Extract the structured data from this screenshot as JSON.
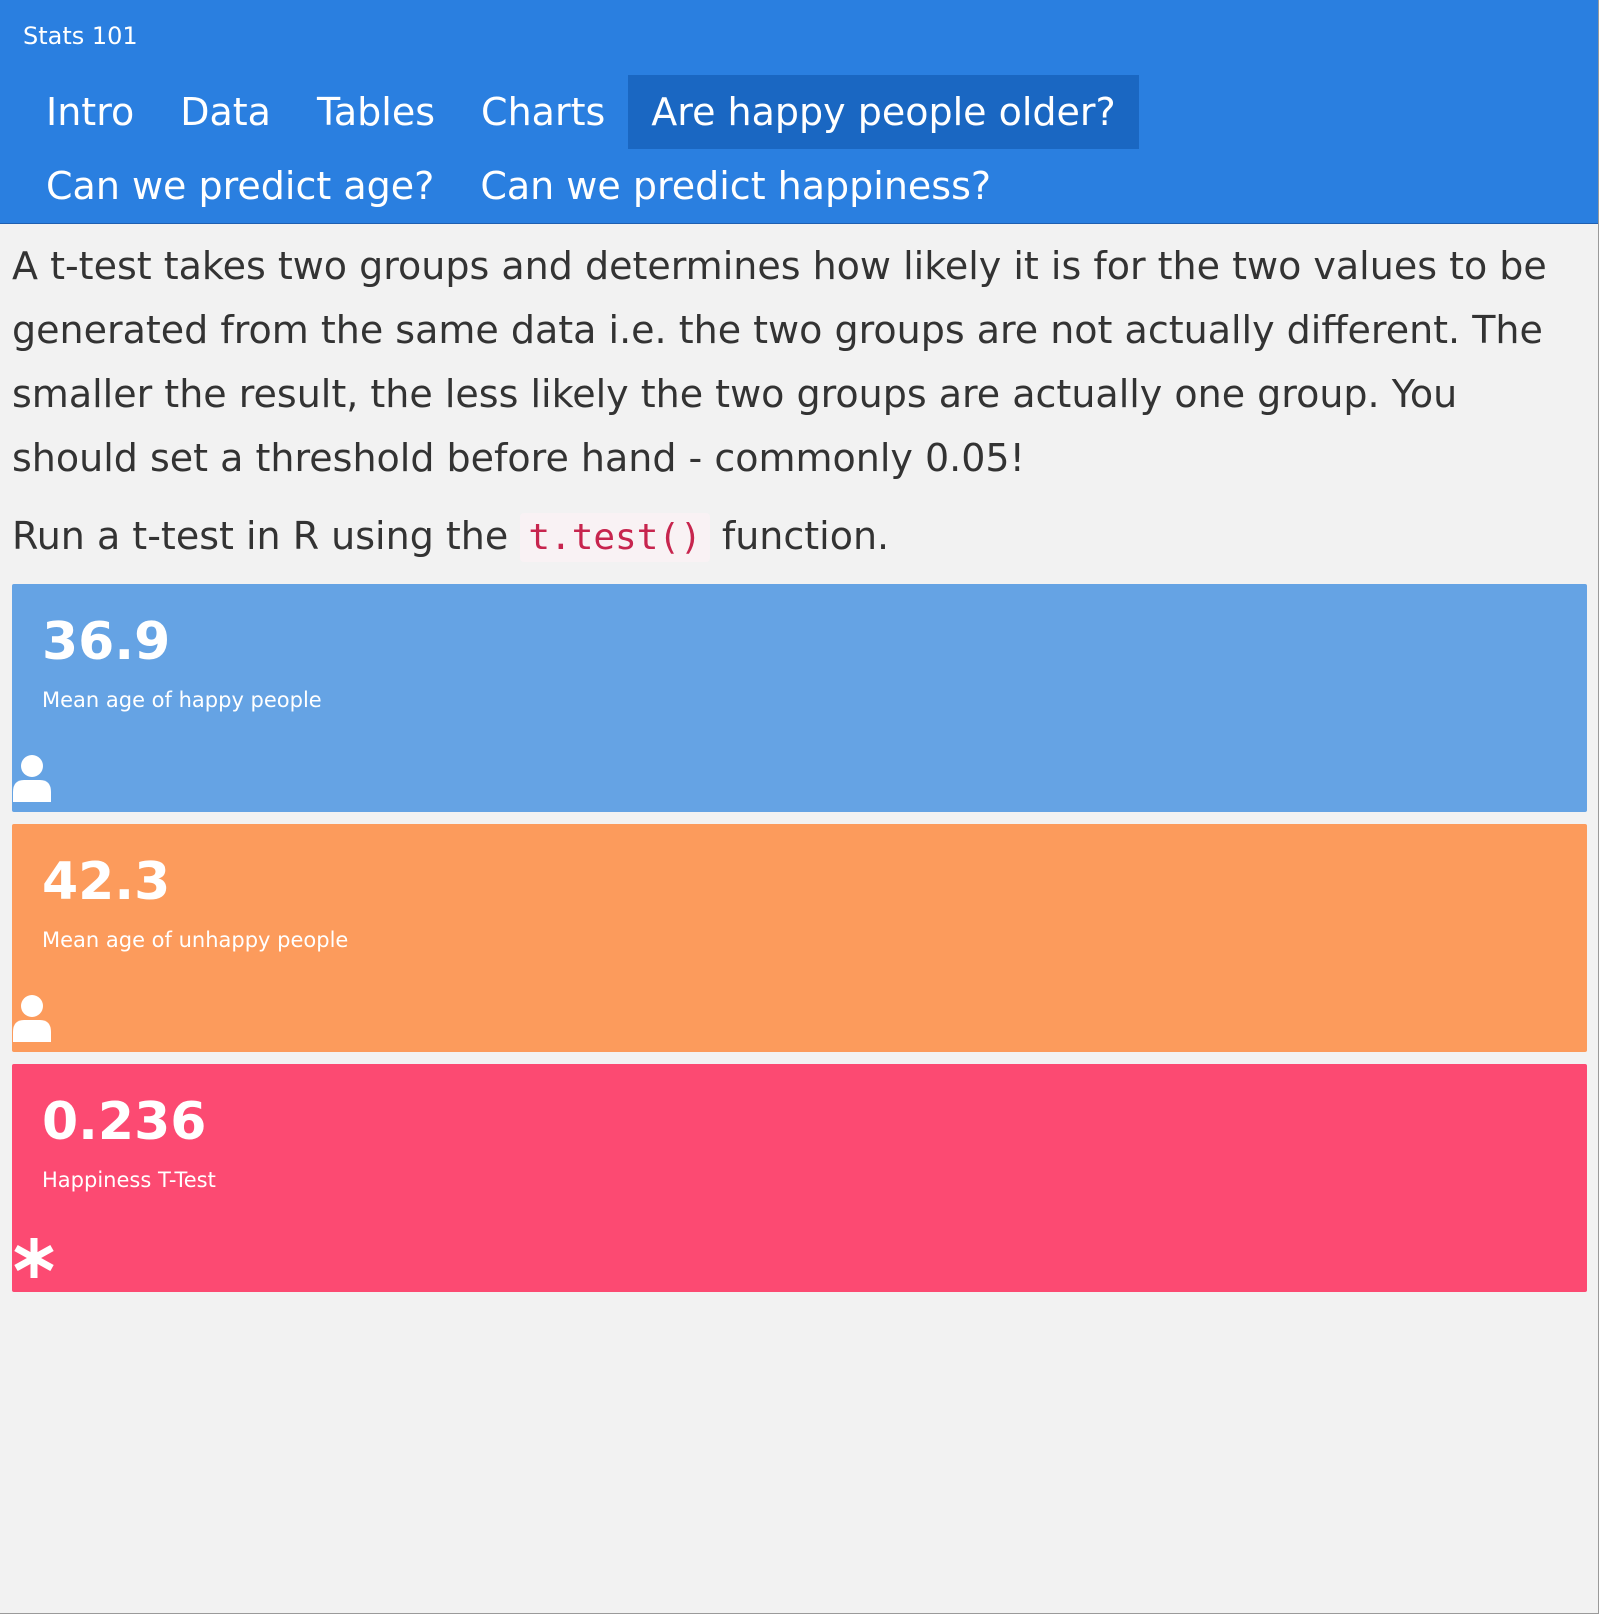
{
  "app": {
    "brand": "Stats 101"
  },
  "nav": {
    "items": [
      {
        "label": "Intro"
      },
      {
        "label": "Data"
      },
      {
        "label": "Tables"
      },
      {
        "label": "Charts"
      },
      {
        "label": "Are happy people older?",
        "active": true
      },
      {
        "label": "Can we predict age?"
      },
      {
        "label": "Can we predict happiness?"
      }
    ]
  },
  "main": {
    "intro_text": "A t-test takes two groups and determines how likely it is for the two values to be generated from the same data i.e. the two groups are not actually different. The smaller the result, the less likely the two groups are actually one group. You should set a threshold before hand - commonly 0.05!",
    "run_prefix": "Run a t-test in R using the ",
    "run_code": "t.test()",
    "run_suffix": " function."
  },
  "value_boxes": [
    {
      "value": "36.9",
      "caption": "Mean age of happy people",
      "icon": "user-icon",
      "color": "#65a3e4"
    },
    {
      "value": "42.3",
      "caption": "Mean age of unhappy people",
      "icon": "user-icon",
      "color": "#fc9b5c"
    },
    {
      "value": "0.236",
      "caption": "Happiness T-Test",
      "icon": "asterisk-icon",
      "color": "#fc4a72"
    }
  ],
  "colors": {
    "navbar": "#2a7fe0",
    "nav_active": "#1a67c2",
    "background": "#f2f2f2",
    "code_text": "#c7254e"
  }
}
